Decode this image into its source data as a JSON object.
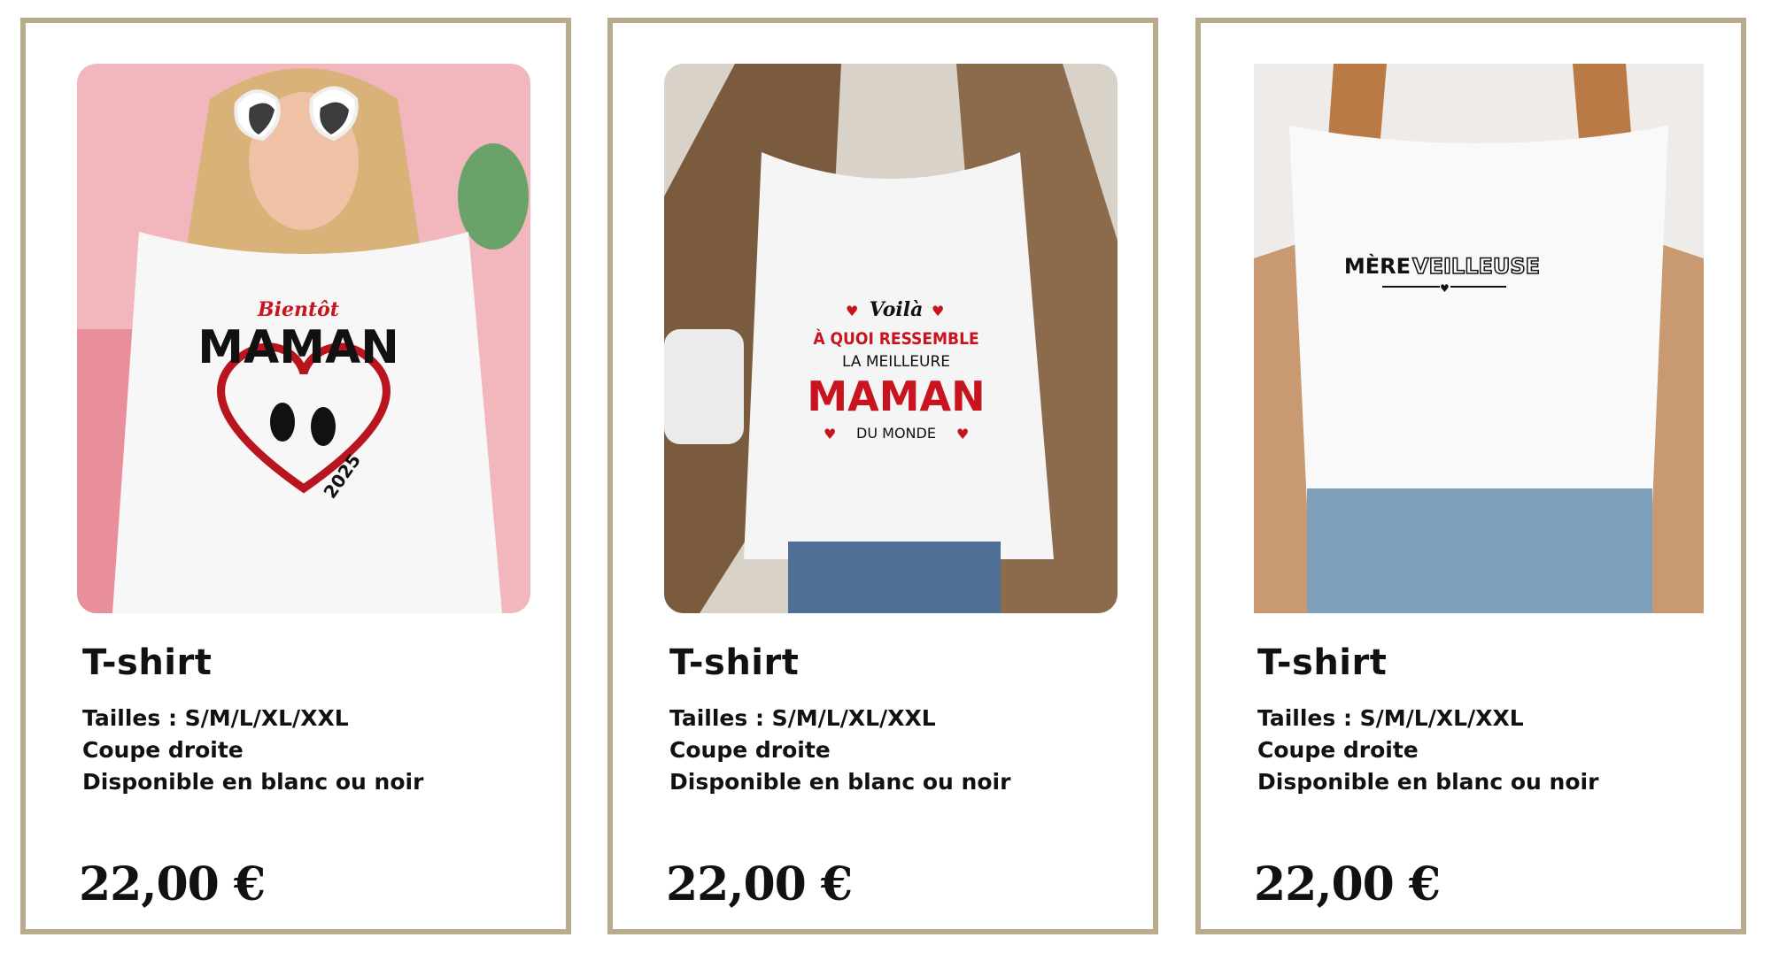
{
  "products": [
    {
      "title": "T-shirt",
      "details": [
        "Tailles : S/M/L/XL/XXL",
        "Coupe droite",
        "Disponible en blanc ou noir"
      ],
      "price": "22,00 €",
      "print": {
        "line1": "Bientôt",
        "line2": "MAMAN",
        "year": "2025"
      }
    },
    {
      "title": "T-shirt",
      "details": [
        "Tailles : S/M/L/XL/XXL",
        "Coupe droite",
        "Disponible en blanc ou noir"
      ],
      "price": "22,00 €",
      "print": {
        "line1": "Voilà",
        "line2": "À QUOI RESSEMBLE",
        "line3": "LA MEILLEURE",
        "line4": "MAMAN",
        "line5": "DU MONDE"
      }
    },
    {
      "title": "T-shirt",
      "details": [
        "Tailles : S/M/L/XL/XXL",
        "Coupe droite",
        "Disponible en blanc ou noir"
      ],
      "price": "22,00 €",
      "print": {
        "word1": "MÈRE",
        "word2": "VEILLEUSE"
      }
    }
  ],
  "colors": {
    "border": "#b9ab8d",
    "accent_red": "#c8141e",
    "text": "#111111"
  }
}
